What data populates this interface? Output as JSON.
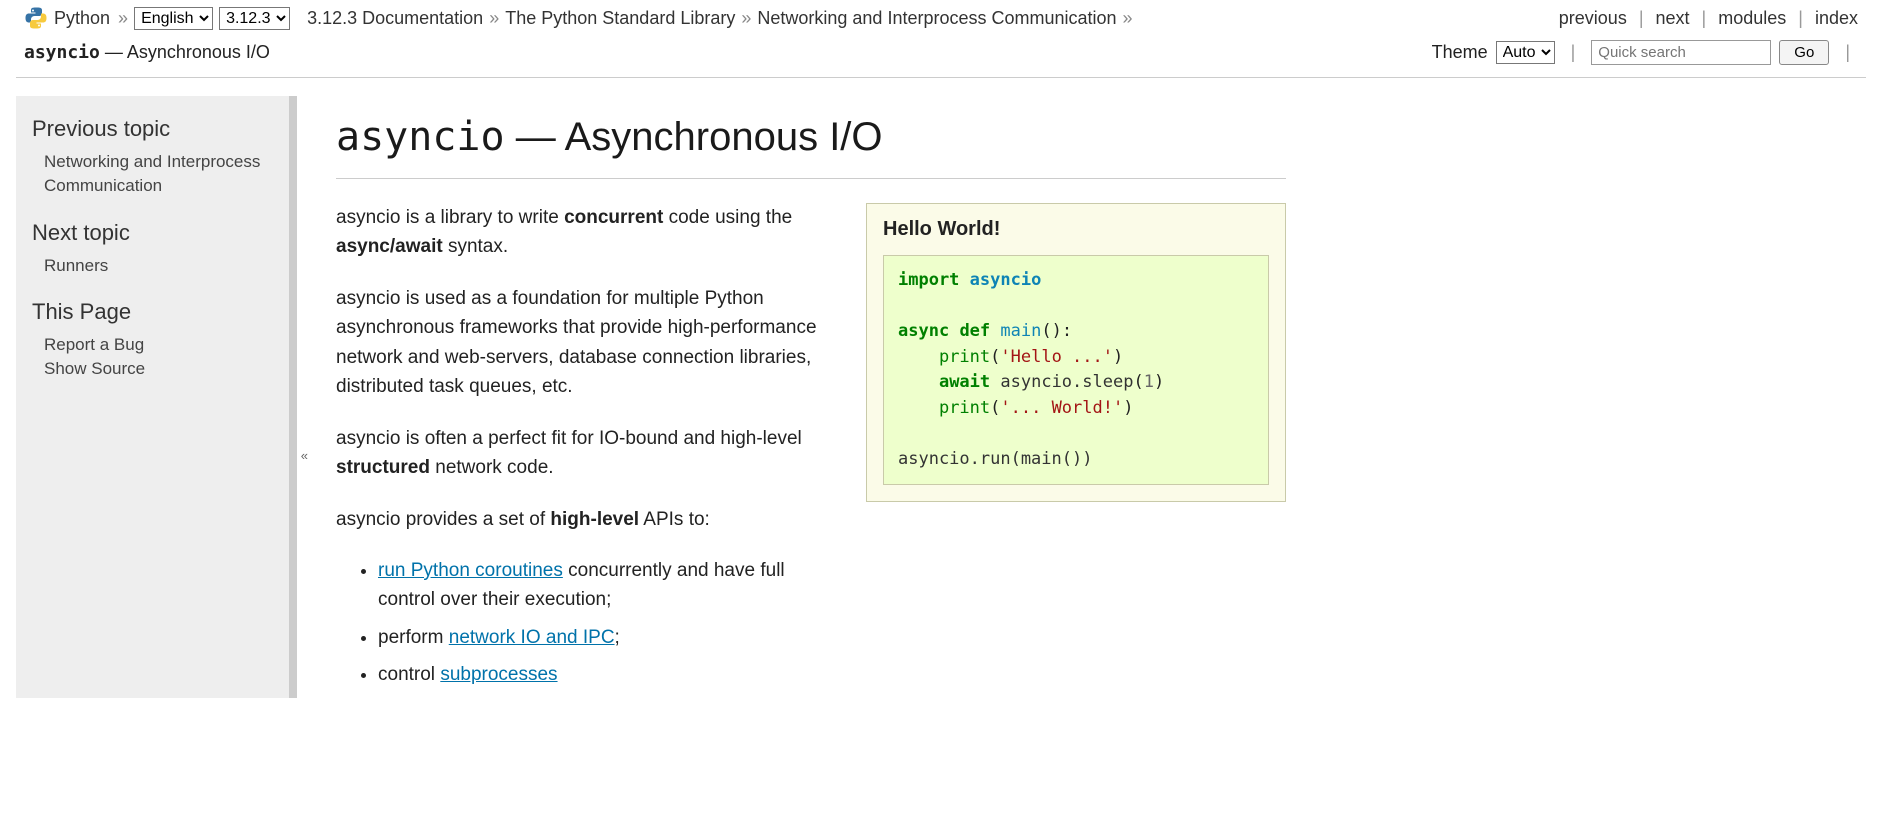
{
  "nav": {
    "python_label": "Python",
    "lang_options": [
      "English"
    ],
    "lang_selected": "English",
    "version_options": [
      "3.12.3"
    ],
    "version_selected": "3.12.3",
    "doc_link": "3.12.3 Documentation",
    "stdlib_link": "The Python Standard Library",
    "ipc_link": "Networking and Interprocess Communication",
    "prev": "previous",
    "next": "next",
    "modules": "modules",
    "index": "index"
  },
  "nav2": {
    "module": "asyncio",
    "title_rest": " — Asynchronous I/O",
    "theme_label": "Theme",
    "theme_options": [
      "Auto"
    ],
    "theme_selected": "Auto",
    "search_placeholder": "Quick search",
    "go": "Go"
  },
  "sidebar": {
    "prev_heading": "Previous topic",
    "prev_link": "Networking and Interprocess Communication",
    "next_heading": "Next topic",
    "next_link": "Runners",
    "thispage_heading": "This Page",
    "report_bug": "Report a Bug",
    "show_source": "Show Source",
    "collapse": "«"
  },
  "page": {
    "title_module": "asyncio",
    "title_rest": " — Asynchronous I/O",
    "p1_a": "asyncio is a library to write ",
    "p1_b": "concurrent",
    "p1_c": " code using the ",
    "p1_d": "async/await",
    "p1_e": " syntax.",
    "p2": "asyncio is used as a foundation for multiple Python asynchro­nous frameworks that provide high-performance network and web-servers, database connection libraries, distributed task queues, etc.",
    "p3_a": "asyncio is often a perfect fit for IO-bound and high-level ",
    "p3_b": "struc­tured",
    "p3_c": " network code.",
    "p4_a": "asyncio provides a set of ",
    "p4_b": "high-level",
    "p4_c": " APIs to:",
    "li1_link": "run Python coroutines",
    "li1_rest": " concurrently and have full control over their execution;",
    "li2_a": "perform ",
    "li2_link": "network IO and IPC",
    "li2_c": ";",
    "li3_a": "control ",
    "li3_link": "subprocesses"
  },
  "topic": {
    "title": "Hello World!",
    "code": {
      "l1_k": "import",
      "l1_nn": "asyncio",
      "l3_k1": "async",
      "l3_k2": "def",
      "l3_nf": "main",
      "l3_p": "():",
      "l4_nb": "print",
      "l4_s": "'Hello ...'",
      "l5_k": "await",
      "l5_n": "asyncio.sleep",
      "l5_m": "1",
      "l6_nb": "print",
      "l6_s": "'... World!'",
      "l8": "asyncio.run(main())"
    }
  }
}
